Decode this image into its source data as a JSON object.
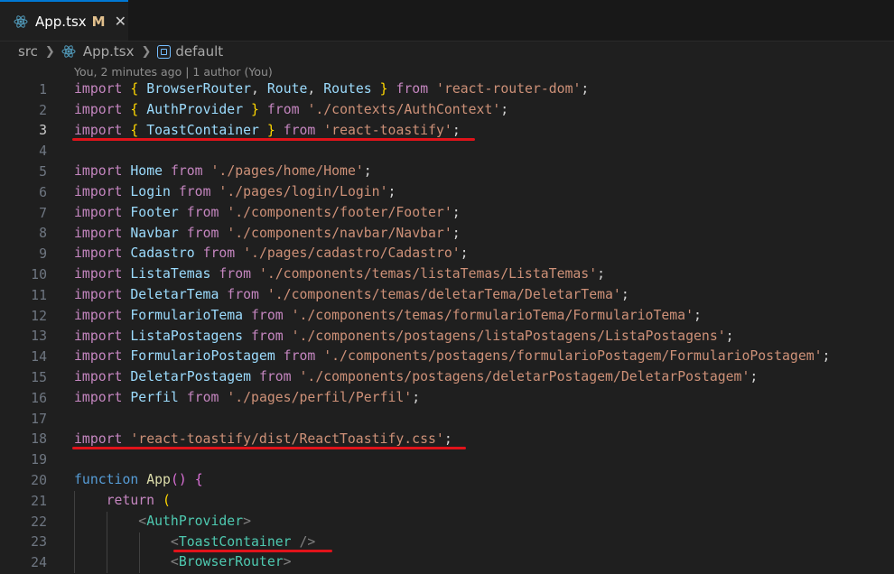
{
  "tab": {
    "icon": "react-icon",
    "filename": "App.tsx",
    "modified": "M",
    "close": "✕"
  },
  "breadcrumb": {
    "folder": "src",
    "file": "App.tsx",
    "symbol": "default"
  },
  "blame": "You, 2 minutes ago | 1 author (You)",
  "lines": [
    {
      "n": "1",
      "t": "import { BrowserRouter, Route, Routes } from 'react-router-dom';"
    },
    {
      "n": "2",
      "t": "import { AuthProvider } from './contexts/AuthContext';"
    },
    {
      "n": "3",
      "t": "import { ToastContainer } from 'react-toastify';"
    },
    {
      "n": "4",
      "t": ""
    },
    {
      "n": "5",
      "t": "import Home from './pages/home/Home';"
    },
    {
      "n": "6",
      "t": "import Login from './pages/login/Login';"
    },
    {
      "n": "7",
      "t": "import Footer from './components/footer/Footer';"
    },
    {
      "n": "8",
      "t": "import Navbar from './components/navbar/Navbar';"
    },
    {
      "n": "9",
      "t": "import Cadastro from './pages/cadastro/Cadastro';"
    },
    {
      "n": "10",
      "t": "import ListaTemas from './components/temas/listaTemas/ListaTemas';"
    },
    {
      "n": "11",
      "t": "import DeletarTema from './components/temas/deletarTema/DeletarTema';"
    },
    {
      "n": "12",
      "t": "import FormularioTema from './components/temas/formularioTema/FormularioTema';"
    },
    {
      "n": "13",
      "t": "import ListaPostagens from './components/postagens/listaPostagens/ListaPostagens';"
    },
    {
      "n": "14",
      "t": "import FormularioPostagem from './components/postagens/formularioPostagem/FormularioPostagem';"
    },
    {
      "n": "15",
      "t": "import DeletarPostagem from './components/postagens/deletarPostagem/DeletarPostagem';"
    },
    {
      "n": "16",
      "t": "import Perfil from './pages/perfil/Perfil';"
    },
    {
      "n": "17",
      "t": ""
    },
    {
      "n": "18",
      "t": "import 'react-toastify/dist/ReactToastify.css';"
    },
    {
      "n": "19",
      "t": ""
    },
    {
      "n": "20",
      "t": "function App() {"
    },
    {
      "n": "21",
      "t": "    return ("
    },
    {
      "n": "22",
      "t": "        <AuthProvider>"
    },
    {
      "n": "23",
      "t": "            <ToastContainer />"
    },
    {
      "n": "24",
      "t": "            <BrowserRouter>"
    }
  ]
}
